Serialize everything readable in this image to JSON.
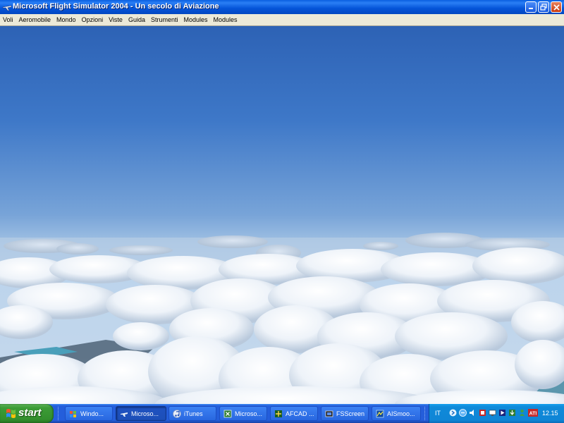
{
  "window": {
    "title": "Microsoft Flight Simulator 2004 - Un secolo di Aviazione"
  },
  "menubar": {
    "items": [
      {
        "label": "Voli"
      },
      {
        "label": "Aeromobile"
      },
      {
        "label": "Mondo"
      },
      {
        "label": "Opzioni"
      },
      {
        "label": "Viste"
      },
      {
        "label": "Guida"
      },
      {
        "label": "Strumenti"
      },
      {
        "label": "Modules"
      },
      {
        "label": "Modules"
      }
    ]
  },
  "taskbar": {
    "start_label": "start",
    "tasks": [
      {
        "label": "Windo...",
        "icon": "windows-explorer-icon"
      },
      {
        "label": "Microso...",
        "icon": "flight-simulator-icon",
        "active": true
      },
      {
        "label": "iTunes",
        "icon": "itunes-icon"
      },
      {
        "label": "Microso...",
        "icon": "excel-icon"
      },
      {
        "label": "AFCAD ...",
        "icon": "afcad-icon"
      },
      {
        "label": "FSScreen",
        "icon": "fsscreen-icon"
      },
      {
        "label": "AISmoo...",
        "icon": "aismooth-icon"
      }
    ],
    "language": "IT",
    "clock": "12.15"
  },
  "colors": {
    "titlebar": "#0454d8",
    "taskbar": "#245edb",
    "start_button": "#3c9c36",
    "tray": "#0f85d6",
    "sky_top": "#2f66b8",
    "sky_horizon": "#b8d2ea"
  }
}
